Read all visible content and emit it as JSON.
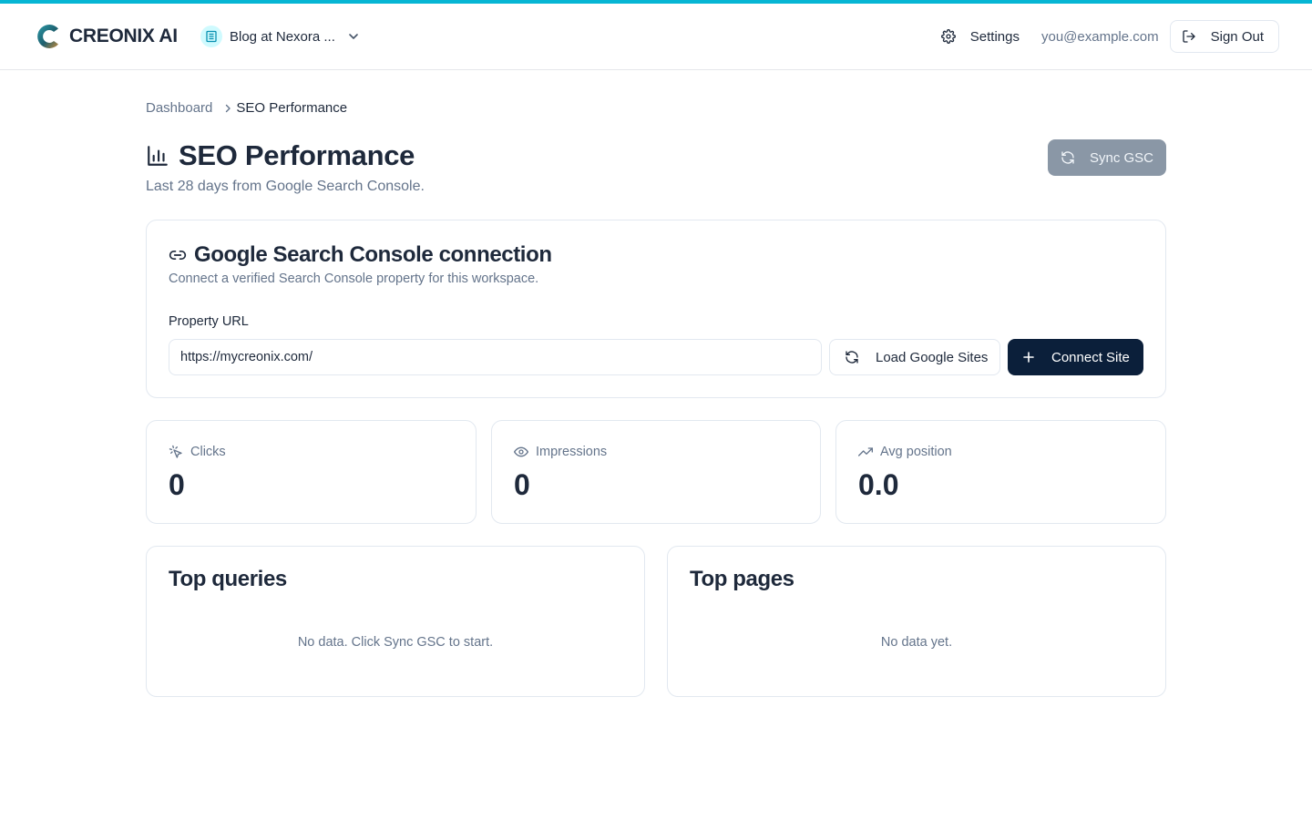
{
  "app": {
    "name": "CREONIX AI",
    "accent_color": "#06b6d4",
    "primary_color": "#0b1f3a"
  },
  "header": {
    "workspace_label": "Blog at Nexora ...",
    "workspace_icon": "building-icon",
    "settings_label": "Settings",
    "user_email": "you@example.com",
    "signout_label": "Sign Out"
  },
  "breadcrumb": {
    "items": [
      "Dashboard",
      "SEO Performance"
    ]
  },
  "page": {
    "title": "SEO Performance",
    "title_icon": "bar-chart-icon",
    "subtitle": "Last 28 days from Google Search Console.",
    "sync_label": "Sync GSC"
  },
  "gsc": {
    "title": "Google Search Console connection",
    "description": "Connect a verified Search Console property for this workspace.",
    "field_label": "Property URL",
    "property_url": "https://mycreonix.com/",
    "load_label": "Load Google Sites",
    "connect_label": "Connect Site"
  },
  "stats": [
    {
      "label": "Clicks",
      "value": "0",
      "icon": "pointer-click-icon"
    },
    {
      "label": "Impressions",
      "value": "0",
      "icon": "eye-icon"
    },
    {
      "label": "Avg position",
      "value": "0.0",
      "icon": "trending-up-icon"
    }
  ],
  "lists": {
    "queries": {
      "title": "Top queries",
      "empty": "No data. Click Sync GSC to start."
    },
    "pages": {
      "title": "Top pages",
      "empty": "No data yet."
    }
  }
}
